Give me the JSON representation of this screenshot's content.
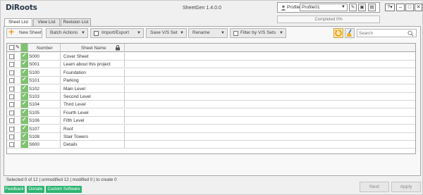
{
  "app": {
    "logo_text": "DiRoots",
    "title": "SheetGen 1.4.0.0",
    "profile_label": "Profile",
    "profile_value": "Profile01",
    "progress_text": "Completed 0%",
    "progress_fraction": 0.0,
    "help_label": "?"
  },
  "tabs": [
    {
      "label": "Sheet List",
      "active": true
    },
    {
      "label": "View List",
      "active": false
    },
    {
      "label": "Revision List",
      "active": false
    }
  ],
  "toolbar": {
    "new_sheet": "New Sheet",
    "batch_actions": "Batch Actions",
    "import_export": "Import/Export",
    "vs_set": "Save V/S Set",
    "rename": "Rename",
    "filter": "Filter by V/S Sets",
    "search_placeholder": "Search"
  },
  "grid": {
    "columns": {
      "number": "Number",
      "name": "Sheet Name"
    },
    "rows": [
      {
        "number": "S000",
        "name": "Cover Sheet"
      },
      {
        "number": "S001",
        "name": "Learn about this project"
      },
      {
        "number": "S100",
        "name": "Foundation"
      },
      {
        "number": "S101",
        "name": "Parking"
      },
      {
        "number": "S102",
        "name": "Main Level"
      },
      {
        "number": "S103",
        "name": "Second Level"
      },
      {
        "number": "S104",
        "name": "Third Level"
      },
      {
        "number": "S105",
        "name": "Fourth Level"
      },
      {
        "number": "S106",
        "name": "Fifth Level"
      },
      {
        "number": "S107",
        "name": "Roof"
      },
      {
        "number": "S108",
        "name": "Stair Towers"
      },
      {
        "number": "S600",
        "name": "Details"
      }
    ]
  },
  "status": "Selected 0 of 12 | unmodified 12 | modified 0 | to create 0",
  "footer": {
    "feedback": "Feedback",
    "donate": "Donate",
    "custom_software": "Custom Software",
    "next": "Next",
    "apply": "Apply"
  },
  "colors": {
    "accent_green": "#7dc36e",
    "button_green": "#2eb472",
    "new_plus": "#f0a020"
  }
}
